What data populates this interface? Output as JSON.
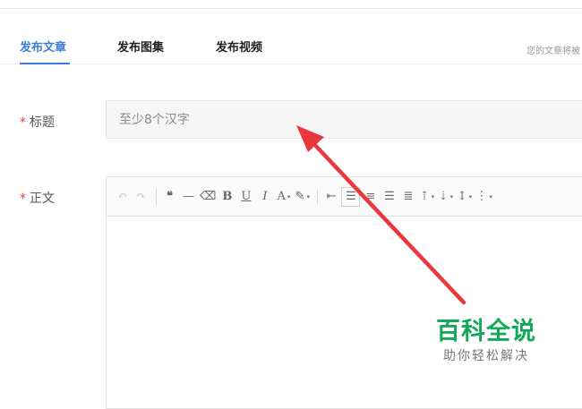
{
  "tabs": [
    {
      "label": "发布文章",
      "active": true
    },
    {
      "label": "发布图集",
      "active": false
    },
    {
      "label": "发布视频",
      "active": false
    }
  ],
  "hint": "您的文章将被",
  "form": {
    "required_mark": "*",
    "title_label": "标题",
    "title_placeholder": "至少8个汉字",
    "body_label": "正文"
  },
  "toolbar": {
    "undo": "↶",
    "redo": "↷",
    "quote": "❝",
    "hr": "—",
    "eraser": "⌫",
    "bold": "B",
    "underline": "U",
    "italic": "I",
    "font_color": "A",
    "highlight": "✎",
    "dropdown": "▾",
    "indent": "⇤",
    "align_left": "☰",
    "align_center": "≡",
    "align_right": "☰",
    "align_justify": "≣",
    "spacing_before": "⇡",
    "spacing_after": "⇣",
    "line_height": "↕",
    "ordered_list": "⋮"
  },
  "watermark": {
    "title": "百科全说",
    "subtitle": "助你轻松解决"
  },
  "colors": {
    "accent": "#3b7fd6",
    "arrow": "#e8383d",
    "watermark_green": "#14a85a",
    "required": "#e84040"
  }
}
